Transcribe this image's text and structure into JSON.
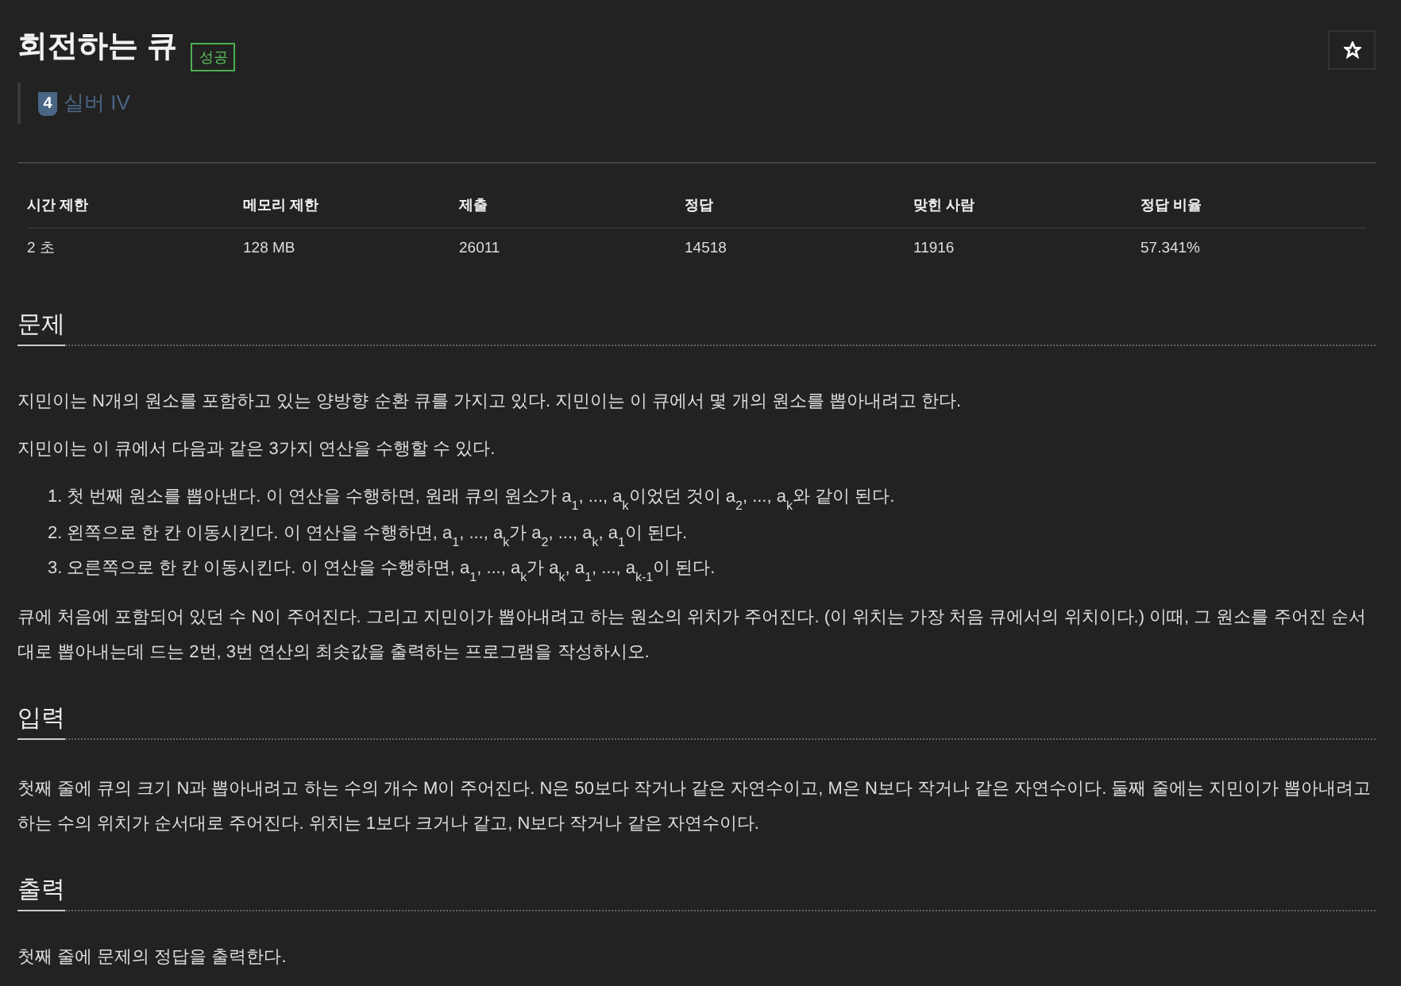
{
  "problem": {
    "title": "회전하는 큐",
    "result_badge": "성공",
    "tier": {
      "number": "4",
      "label": "실버 IV"
    }
  },
  "info_table": {
    "columns": [
      "시간 제한",
      "메모리 제한",
      "제출",
      "정답",
      "맞힌 사람",
      "정답 비율"
    ],
    "rows": [
      [
        "2 초",
        "128 MB",
        "26011",
        "14518",
        "11916",
        "57.341%"
      ]
    ]
  },
  "sections": [
    {
      "heading": "문제",
      "blocks": [
        {
          "kind": "paragraph",
          "text": "지민이는 N개의 원소를 포함하고 있는 양방향 순환 큐를 가지고 있다. 지민이는 이 큐에서 몇 개의 원소를 뽑아내려고 한다."
        },
        {
          "kind": "paragraph",
          "text": "지민이는 이 큐에서 다음과 같은 3가지 연산을 수행할 수 있다."
        },
        {
          "kind": "ordered_list",
          "items": [
            {
              "number": "1.",
              "text": "첫 번째 원소를 뽑아낸다. 이 연산을 수행하면, 원래 큐의 원소가 a$_{1}$, ..., a$_{k}$이었던 것이 a$_{2}$, ..., a$_{k}$와 같이 된다."
            },
            {
              "number": "2.",
              "text": "왼쪽으로 한 칸 이동시킨다. 이 연산을 수행하면, a$_{1}$, ..., a$_{k}$가 a$_{2}$, ..., a$_{k}$, a$_{1}$이 된다."
            },
            {
              "number": "3.",
              "text": "오른쪽으로 한 칸 이동시킨다. 이 연산을 수행하면, a$_{1}$, ..., a$_{k}$가 a$_{k}$, a$_{1}$, ..., a$_{k-1}$이 된다."
            }
          ]
        },
        {
          "kind": "paragraph",
          "text": "큐에 처음에 포함되어 있던 수 N이 주어진다. 그리고 지민이가 뽑아내려고 하는 원소의 위치가 주어진다. (이 위치는 가장 처음 큐에서의 위치이다.) 이때, 그 원소를 주어진 순서대로 뽑아내는데 드는 2번, 3번 연산의 최솟값을 출력하는 프로그램을 작성하시오."
        }
      ]
    },
    {
      "heading": "입력",
      "blocks": [
        {
          "kind": "paragraph",
          "text": "첫째 줄에 큐의 크기 N과 뽑아내려고 하는 수의 개수 M이 주어진다. N은 50보다 작거나 같은 자연수이고, M은 N보다 작거나 같은 자연수이다. 둘째 줄에는 지민이가 뽑아내려고 하는 수의 위치가 순서대로 주어진다. 위치는 1보다 크거나 같고, N보다 작거나 같은 자연수이다."
        }
      ]
    },
    {
      "heading": "출력",
      "blocks": [
        {
          "kind": "paragraph",
          "text": "첫째 줄에 문제의 정답을 출력한다."
        }
      ]
    }
  ]
}
